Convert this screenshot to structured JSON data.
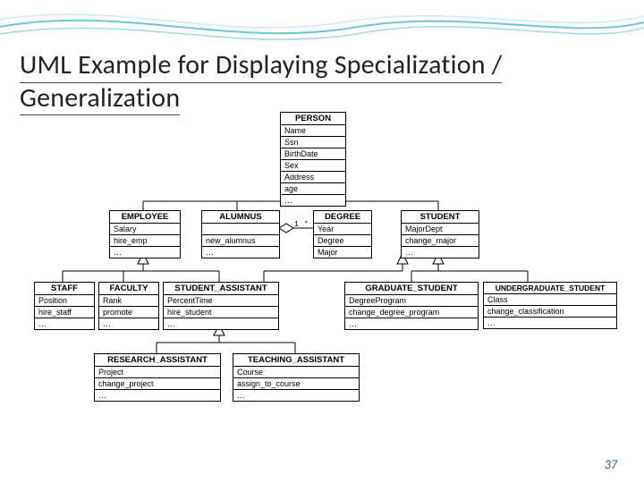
{
  "title_line1": "UML Example for Displaying Specialization /",
  "title_line2": "Generalization",
  "page_number": "37",
  "assoc": {
    "mult_left": "1",
    "mult_right": "*"
  },
  "classes": {
    "person": {
      "name": "PERSON",
      "attrs": [
        "Name",
        "Ssn",
        "BirthDate",
        "Sex",
        "Address"
      ],
      "ops": [
        "age",
        "…"
      ]
    },
    "employee": {
      "name": "EMPLOYEE",
      "attrs": [
        "Salary"
      ],
      "ops": [
        "hire_emp",
        "…"
      ]
    },
    "alumnus": {
      "name": "ALUMNUS",
      "attrs": [],
      "ops": [
        "new_alumnus",
        "…"
      ]
    },
    "degree": {
      "name": "DEGREE",
      "attrs": [
        "Year",
        "Degree",
        "Major"
      ],
      "ops": []
    },
    "student": {
      "name": "STUDENT",
      "attrs": [
        "MajorDept"
      ],
      "ops": [
        "change_major",
        "…"
      ]
    },
    "staff": {
      "name": "STAFF",
      "attrs": [
        "Position"
      ],
      "ops": [
        "hire_staff",
        "…"
      ]
    },
    "faculty": {
      "name": "FACULTY",
      "attrs": [
        "Rank"
      ],
      "ops": [
        "promote",
        "…"
      ]
    },
    "sa": {
      "name": "STUDENT_ASSISTANT",
      "attrs": [
        "PercentTime"
      ],
      "ops": [
        "hire_student",
        "…"
      ]
    },
    "grad": {
      "name": "GRADUATE_STUDENT",
      "attrs": [
        "DegreeProgram"
      ],
      "ops": [
        "change_degree_program",
        "…"
      ]
    },
    "ugrad": {
      "name": "UNDERGRADUATE_STUDENT",
      "attrs": [
        "Class"
      ],
      "ops": [
        "change_classification",
        "…"
      ]
    },
    "ra": {
      "name": "RESEARCH_ASSISTANT",
      "attrs": [
        "Project"
      ],
      "ops": [
        "change_project",
        "…"
      ]
    },
    "ta": {
      "name": "TEACHING_ASSISTANT",
      "attrs": [
        "Course"
      ],
      "ops": [
        "assign_to_course",
        "…"
      ]
    }
  }
}
